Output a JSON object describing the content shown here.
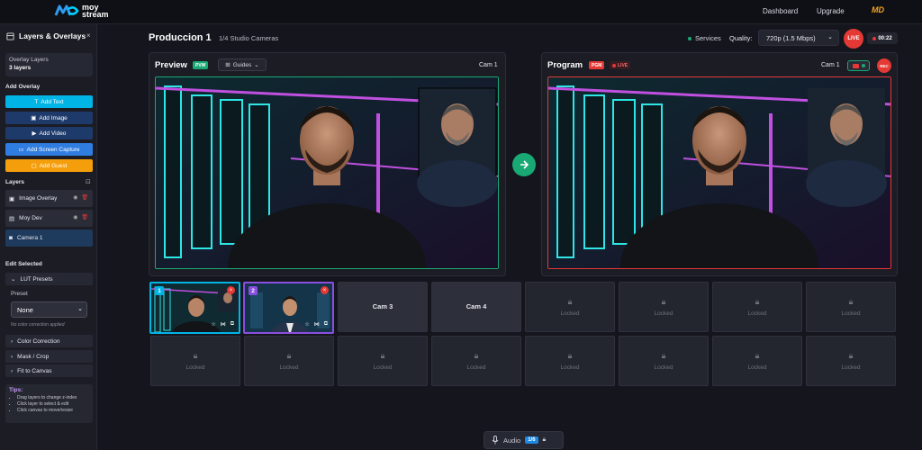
{
  "brand": {
    "line1": "moy",
    "line2": "stream"
  },
  "nav": {
    "dashboard": "Dashboard",
    "upgrade": "Upgrade",
    "partner_logo": "MD"
  },
  "sidebar": {
    "title": "Layers & Overlays",
    "overlay_box": {
      "label": "Overlay Layers",
      "count": "3 layers"
    },
    "add_overlay_label": "Add Overlay",
    "buttons": [
      {
        "label": "Add Text",
        "color": "#00b4e6"
      },
      {
        "label": "Add Image",
        "color": "#1e3a6a"
      },
      {
        "label": "Add Video",
        "color": "#1e3a6a"
      },
      {
        "label": "Add Screen Capture",
        "color": "#2f7de0"
      },
      {
        "label": "Add Guest",
        "color": "#f59e0b"
      }
    ],
    "layers_label": "Layers",
    "layers": [
      {
        "label": "Image Overlay",
        "icon": "image-icon"
      },
      {
        "label": "Moy Dev",
        "icon": "document-icon"
      },
      {
        "label": "Camera 1",
        "icon": "camera-icon"
      }
    ],
    "edit_selected_label": "Edit Selected",
    "lut_presets_label": "LUT Presets",
    "preset_label": "Preset",
    "preset_value": "None",
    "no_color_note": "No color correction applied",
    "collapsibles": [
      "Color Correction",
      "Mask / Crop",
      "Fit to Canvas"
    ],
    "tips": {
      "title": "Tips:",
      "items": [
        "Drag layers to change z-index",
        "Click layer to select & edit",
        "Click canvas to move/resize"
      ]
    }
  },
  "header": {
    "title": "Produccion 1",
    "subtitle": "1/4 Studio Cameras",
    "services": "Services",
    "quality_label": "Quality:",
    "quality_value": "720p (1.5 Mbps)",
    "live_button": "LIVE",
    "timer": "00:22"
  },
  "preview": {
    "title": "Preview",
    "tag": "PVW",
    "guides": "Guides",
    "camera": "Cam 1"
  },
  "program": {
    "title": "Program",
    "tag": "PGM",
    "live_tag": "LIVE",
    "camera": "Cam 1",
    "rec": "REC"
  },
  "cameras": {
    "row1": [
      {
        "type": "thumb",
        "number": "1"
      },
      {
        "type": "thumb",
        "number": "2"
      },
      {
        "type": "named",
        "label": "Cam 3"
      },
      {
        "type": "named",
        "label": "Cam 4"
      },
      {
        "type": "locked",
        "label": "Locked"
      },
      {
        "type": "locked",
        "label": "Locked"
      },
      {
        "type": "locked",
        "label": "Locked"
      },
      {
        "type": "locked",
        "label": "Locked"
      }
    ],
    "row2": [
      {
        "type": "locked",
        "label": "Locked"
      },
      {
        "type": "locked",
        "label": "Locked"
      },
      {
        "type": "locked",
        "label": "Locked"
      },
      {
        "type": "locked",
        "label": "Locked"
      },
      {
        "type": "locked",
        "label": "Locked"
      },
      {
        "type": "locked",
        "label": "Locked"
      },
      {
        "type": "locked",
        "label": "Locked"
      },
      {
        "type": "locked",
        "label": "Locked"
      }
    ]
  },
  "audio": {
    "label": "Audio",
    "count": "1/6"
  },
  "colors": {
    "accent_green": "#19a974",
    "live_red": "#e53935",
    "cyan": "#00b4e6",
    "neon_purple": "#c050e0",
    "neon_cyan": "#2ee6e6"
  }
}
